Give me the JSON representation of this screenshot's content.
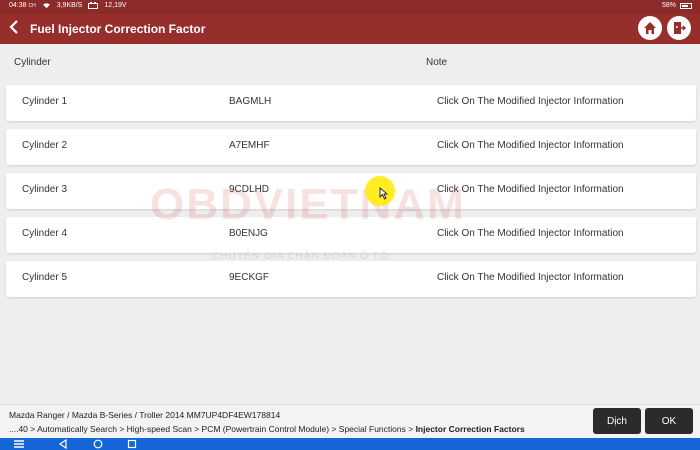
{
  "status": {
    "time": "04:38",
    "time_suffix": "CH",
    "speed": "3,9KB/S",
    "voltage": "12,19V",
    "battery": "58%"
  },
  "header": {
    "title": "Fuel Injector Correction Factor"
  },
  "table": {
    "col_cylinder": "Cylinder",
    "col_note": "Note",
    "rows": [
      {
        "cylinder": "Cylinder 1",
        "code": "BAGMLH",
        "note": "Click On The Modified Injector Information"
      },
      {
        "cylinder": "Cylinder 2",
        "code": "A7EMHF",
        "note": "Click On The Modified Injector Information"
      },
      {
        "cylinder": "Cylinder 3",
        "code": "9CDLHD",
        "note": "Click On The Modified Injector Information"
      },
      {
        "cylinder": "Cylinder 4",
        "code": "B0ENJG",
        "note": "Click On The Modified Injector Information"
      },
      {
        "cylinder": "Cylinder 5",
        "code": "9ECKGF",
        "note": "Click On The Modified Injector Information"
      }
    ]
  },
  "watermark": {
    "brand": "OBDVIETNAM",
    "tagline": "CHUYÊN GIA CHẨN ĐOÁN Ô TÔ"
  },
  "footer": {
    "vehicle": "Mazda  Ranger / Mazda B-Series / Troller 2014   MM7UP4DF4EW178814",
    "path": "....40 > Automatically Search > High-speed Scan > PCM (Powertrain Control Module) > Special Functions > ",
    "path_current": "Injector Correction Factors",
    "btn_translate": "Dịch",
    "btn_ok": "OK"
  },
  "icons": {
    "home": "home-icon",
    "exit": "exit-icon",
    "back": "back-arrow-icon"
  },
  "colors": {
    "header": "#962f2c",
    "navbar": "#1565d8"
  }
}
